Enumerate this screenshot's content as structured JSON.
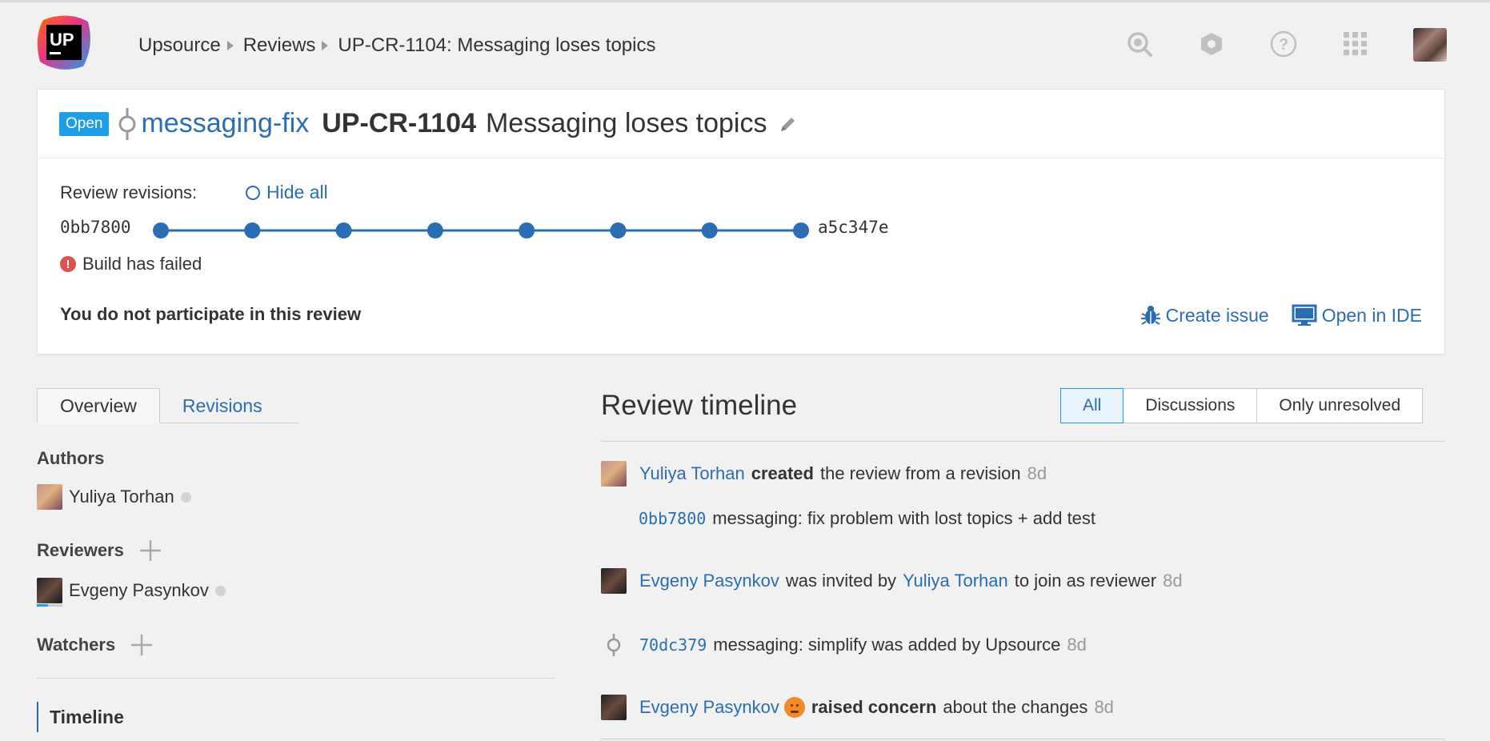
{
  "logo": {
    "text": "UP"
  },
  "breadcrumb": {
    "root": "Upsource",
    "section": "Reviews",
    "current": "UP-CR-1104: Messaging loses topics"
  },
  "header_icons": [
    "search-icon",
    "hexagon-icon",
    "help-icon",
    "apps-grid-icon"
  ],
  "review": {
    "status": "Open",
    "branch": "messaging-fix",
    "id": "UP-CR-1104",
    "title": "Messaging loses topics",
    "revisions_label": "Review revisions:",
    "hide_all": "Hide all",
    "first_revision": "0bb7800",
    "last_revision": "a5c347e",
    "revision_count": 8,
    "build_status": "Build has failed",
    "participation": "You do not participate in this review",
    "create_issue": "Create issue",
    "open_in_ide": "Open in IDE"
  },
  "tabs": {
    "overview": "Overview",
    "revisions": "Revisions"
  },
  "authors": {
    "title": "Authors",
    "people": [
      "Yuliya Torhan"
    ]
  },
  "reviewers": {
    "title": "Reviewers",
    "people": [
      "Evgeny Pasynkov"
    ]
  },
  "watchers": {
    "title": "Watchers"
  },
  "left_nav": {
    "timeline": "Timeline"
  },
  "timeline": {
    "title": "Review timeline",
    "filters": {
      "all": "All",
      "discussions": "Discussions",
      "unresolved": "Only unresolved"
    },
    "events": {
      "e1": {
        "user": "Yuliya Torhan",
        "action": "created",
        "rest": "the review from a revision",
        "time": "8d"
      },
      "e2": {
        "commit": "0bb7800",
        "message": "messaging: fix problem with lost topics + add test"
      },
      "e3": {
        "user": "Evgeny Pasynkov",
        "mid": "was invited by",
        "by": "Yuliya Torhan",
        "rest": "to join as reviewer",
        "time": "8d"
      },
      "e4": {
        "commit": "70dc379",
        "message": "messaging: simplify was added by Upsource",
        "time": "8d"
      },
      "e5": {
        "user": "Evgeny Pasynkov",
        "action": "raised concern",
        "rest": "about the changes",
        "time": "8d"
      }
    }
  },
  "colors": {
    "accent": "#2a6db3",
    "badge": "#1f9ee8",
    "error": "#d9534f",
    "concern": "#f08a2a"
  }
}
